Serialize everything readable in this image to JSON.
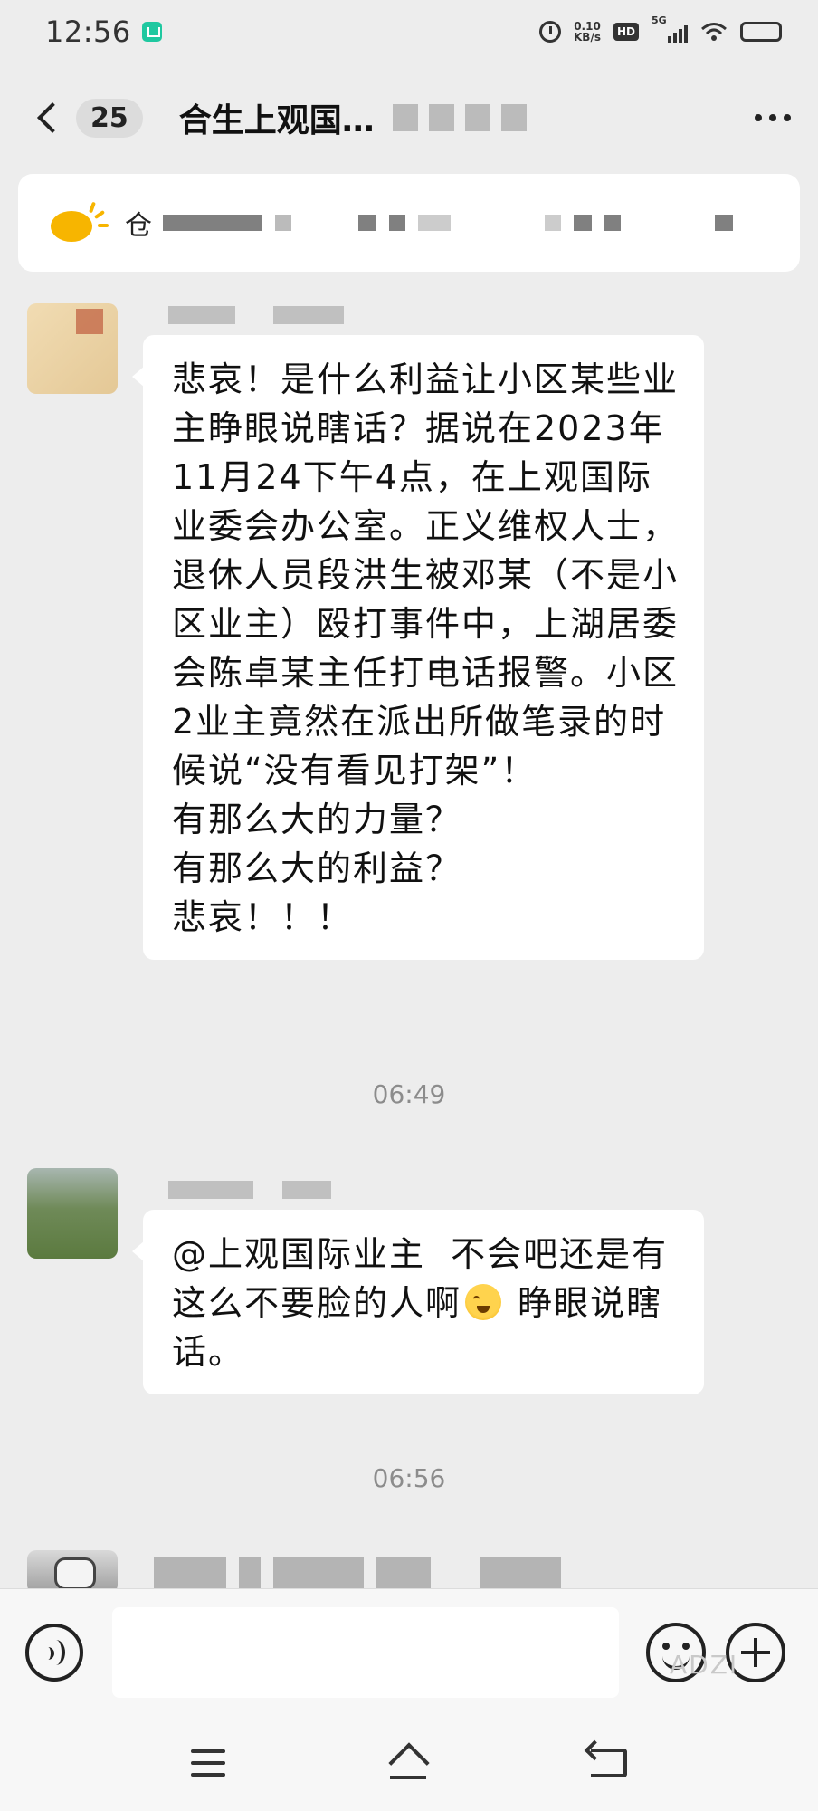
{
  "status_bar": {
    "time": "12:56",
    "net_speed_value": "0.10",
    "net_speed_unit": "KB/s",
    "hd_label": "HD",
    "network_label": "5G",
    "icons": [
      "app-icon",
      "alarm-icon",
      "signal-icon",
      "wifi-icon",
      "battery-icon"
    ]
  },
  "header": {
    "unread_count": "25",
    "title": "合生上观国…"
  },
  "announcement": {
    "text": "仓"
  },
  "messages": [
    {
      "type": "text",
      "text": "悲哀！是什么利益让小区某些业主睁眼说瞎话？据说在2023年11月24下午4点，在上观国际业委会办公室。正义维权人士，退休人员段洪生被邓某（不是小区业主）殴打事件中，上湖居委会陈卓某主任打电话报警。小区2业主竟然在派出所做笔录的时候说“没有看见打架”！\n有那么大的力量？\n有那么大的利益？\n悲哀！！！"
    },
    {
      "type": "timestamp",
      "text": "06:49"
    },
    {
      "type": "text",
      "text_before_emoji": "@上观国际业主  不会吧还是有这么不要脸的人啊",
      "emoji": "facepalm-emoji",
      "text_after_emoji": " 睁眼说瞎话。"
    },
    {
      "type": "timestamp",
      "text": "06:56"
    }
  ],
  "input_bar": {
    "text_value": "",
    "icons": [
      "voice-icon",
      "emoji-icon",
      "plus-icon"
    ]
  },
  "watermark": "ADZI",
  "colors": {
    "background": "#ededed",
    "bubble": "#ffffff",
    "accent": "#f7b500"
  }
}
